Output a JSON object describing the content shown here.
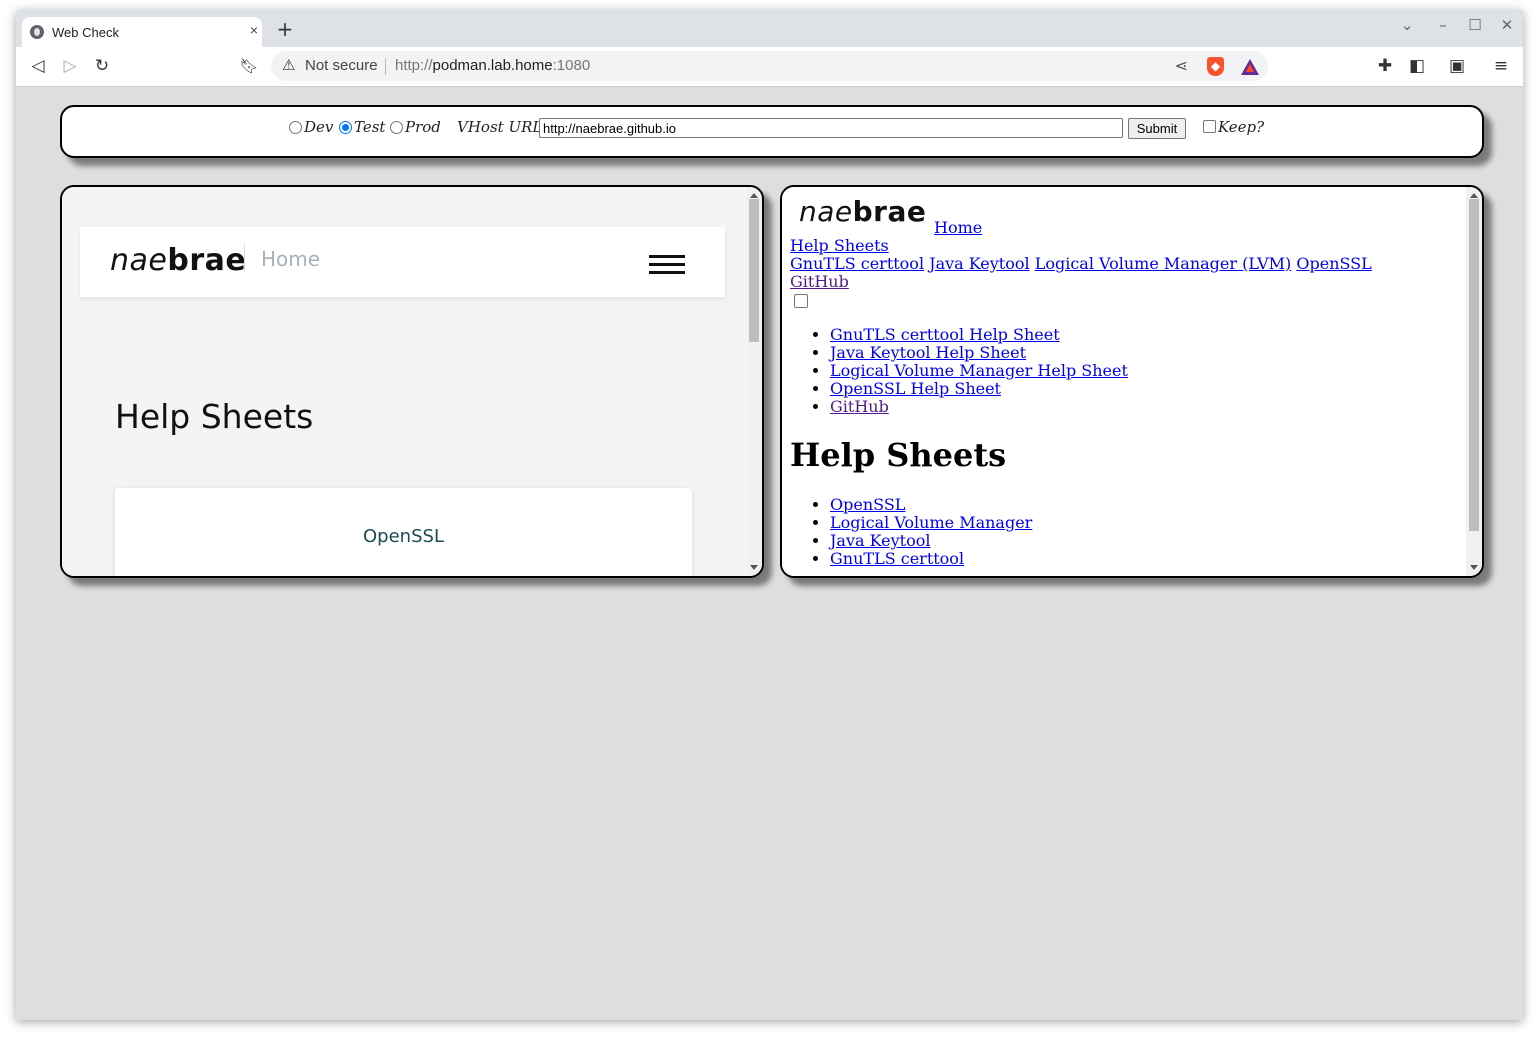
{
  "browser": {
    "tab_title": "Web Check",
    "tab_close": "×",
    "new_tab": "+",
    "security_label": "Not secure",
    "url_scheme": "http://",
    "url_host": "podman.lab.home",
    "url_port": ":1080"
  },
  "form": {
    "env_options": [
      {
        "label": "Dev",
        "selected": false
      },
      {
        "label": "Test",
        "selected": true
      },
      {
        "label": "Prod",
        "selected": false
      }
    ],
    "vhost_label": "VHost URL:",
    "vhost_value": "http://naebrae.github.io",
    "submit_label": "Submit",
    "keep_label": "Keep?",
    "keep_checked": false
  },
  "left_site": {
    "logo_nae": "nae",
    "logo_brae": "brae",
    "nav_home": "Home",
    "heading": "Help Sheets",
    "card_title": "OpenSSL"
  },
  "right_site": {
    "logo_nae": "nae",
    "logo_brae": "brae",
    "home_link": "Home",
    "help_sheets_link": "Help Sheets",
    "nav_links": [
      "GnuTLS certtool",
      "Java Keytool",
      "Logical Volume Manager (LVM)",
      "OpenSSL"
    ],
    "github_link": "GitHub",
    "menu_items": [
      "GnuTLS certtool Help Sheet",
      "Java Keytool Help Sheet",
      "Logical Volume Manager Help Sheet",
      "OpenSSL Help Sheet",
      "GitHub"
    ],
    "heading": "Help Sheets",
    "sheet_items": [
      "OpenSSL",
      "Logical Volume Manager",
      "Java Keytool",
      "GnuTLS certtool"
    ]
  },
  "colors": {
    "radio_accent": "#0075ff",
    "link": "#0000ee",
    "visited_link": "#551a8b",
    "card_title": "#1c4a52",
    "nav_home": "#a8b0b8",
    "brave_brand": "#fb542b"
  },
  "icons": [
    "globe-icon",
    "back-icon",
    "forward-icon",
    "reload-icon",
    "bookmark-icon",
    "warning-icon",
    "share-icon",
    "brave-shield-icon",
    "bat-rewards-icon",
    "extensions-icon",
    "sidebar-icon",
    "wallet-icon",
    "menu-icon",
    "minimize-icon",
    "maximize-icon",
    "close-icon",
    "chevron-down-icon"
  ]
}
